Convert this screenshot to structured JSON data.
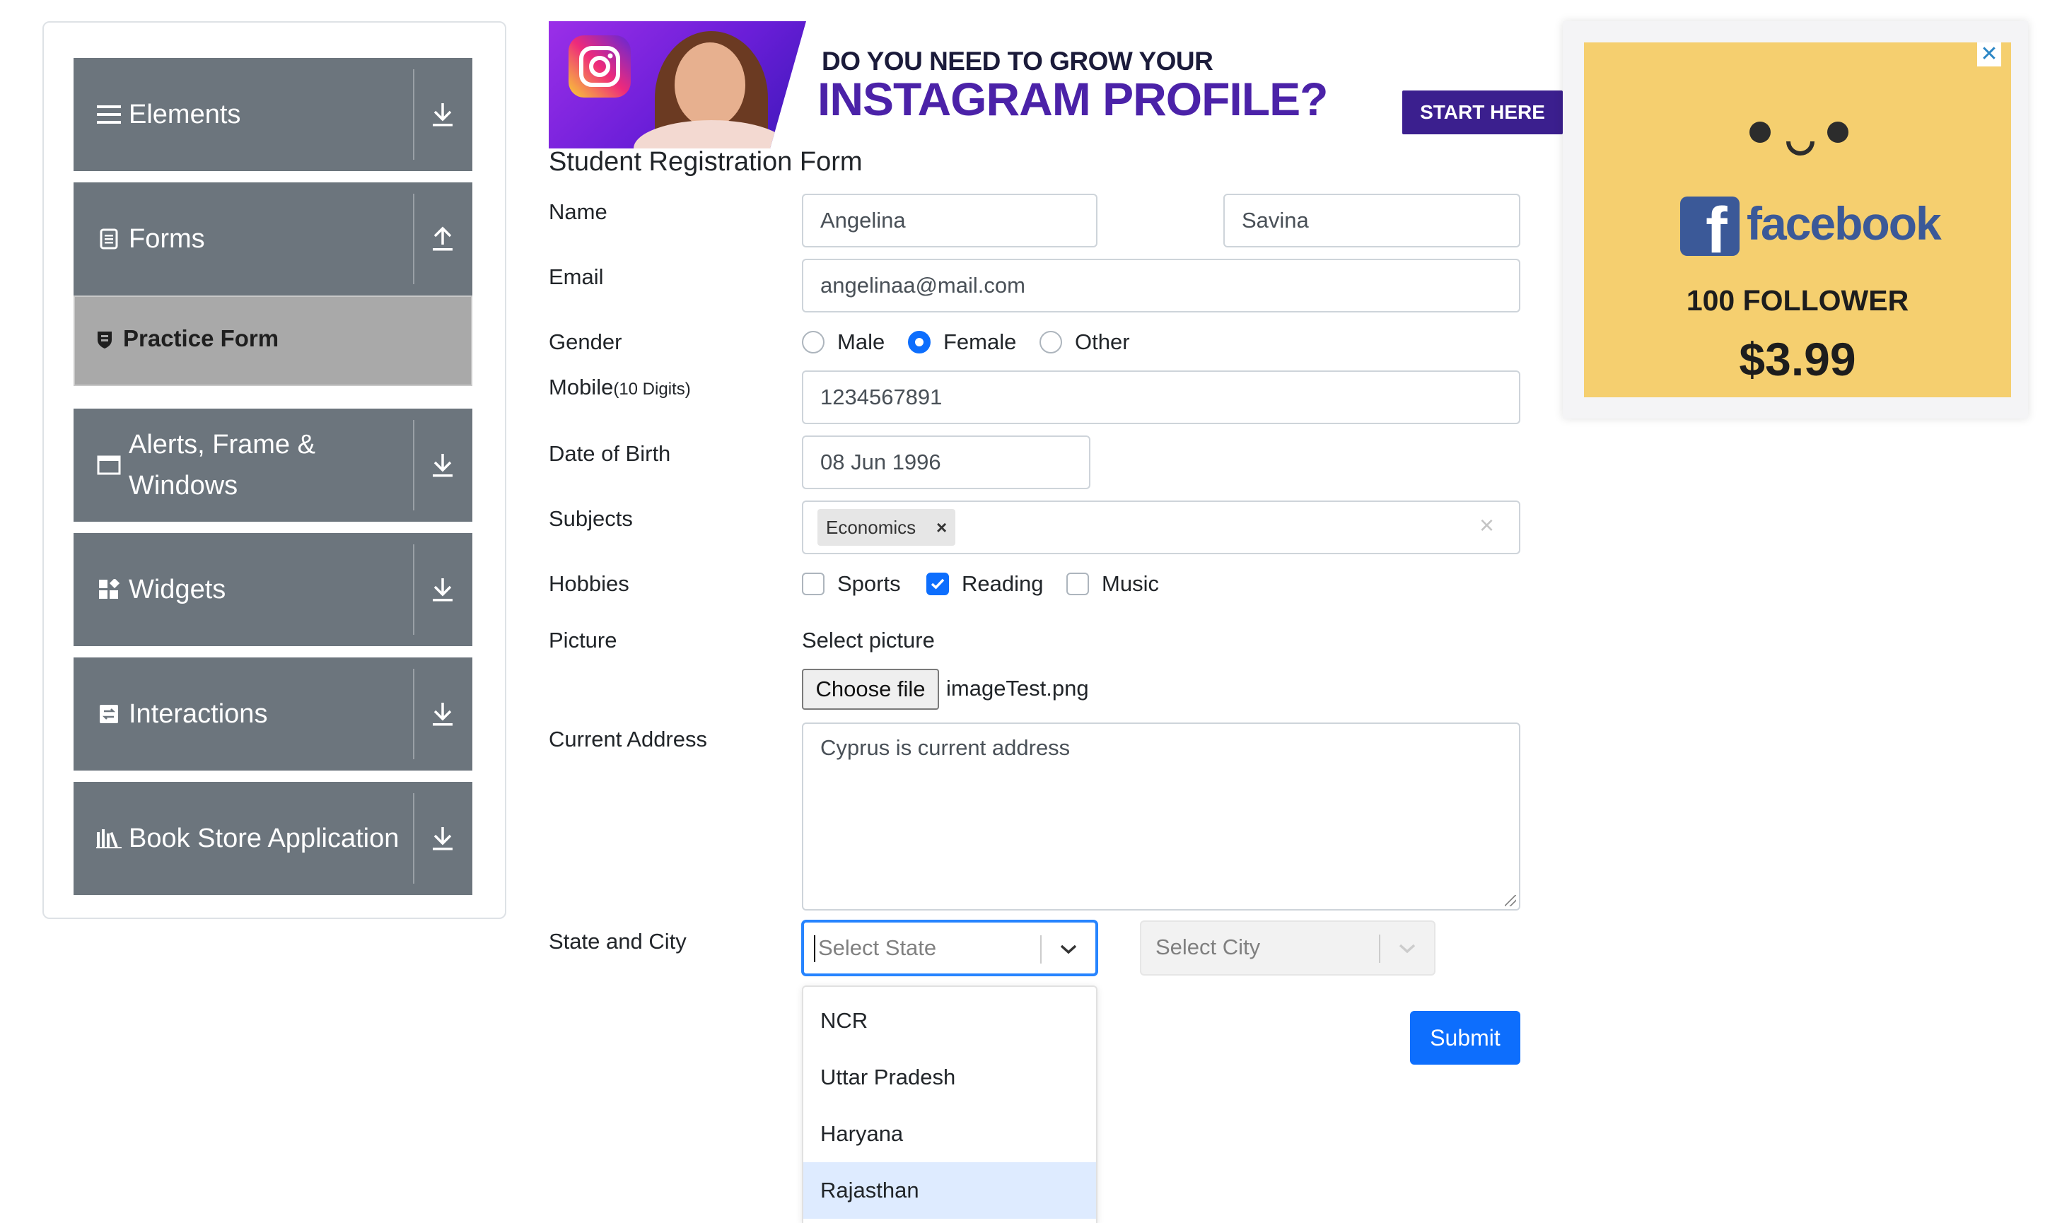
{
  "sidebar": {
    "groups": [
      {
        "label": "Elements",
        "icon": "list-icon",
        "arrow": "download-arrow-icon"
      },
      {
        "label": "Forms",
        "icon": "document-icon",
        "arrow": "upload-arrow-icon"
      },
      {
        "label": "Alerts, Frame & Windows",
        "icon": "window-icon",
        "arrow": "download-arrow-icon"
      },
      {
        "label": "Widgets",
        "icon": "widgets-icon",
        "arrow": "download-arrow-icon"
      },
      {
        "label": "Interactions",
        "icon": "interaction-icon",
        "arrow": "download-arrow-icon"
      },
      {
        "label": "Book Store Application",
        "icon": "books-icon",
        "arrow": "download-arrow-icon"
      }
    ],
    "active_item": {
      "label": "Practice Form",
      "icon": "shield-icon"
    }
  },
  "top_ad": {
    "line1": "DO YOU NEED TO GROW YOUR",
    "line2": "INSTAGRAM PROFILE?",
    "cta": "START HERE"
  },
  "side_ad": {
    "brand": "facebook",
    "brand_letter": "f",
    "headline": "100 FOLLOWER",
    "price": "$3.99",
    "close": "✕"
  },
  "form": {
    "title": "Student Registration Form",
    "name": {
      "label": "Name",
      "first": "Angelina",
      "last": "Savina"
    },
    "email": {
      "label": "Email",
      "value": "angelinaa@mail.com"
    },
    "gender": {
      "label": "Gender",
      "options": [
        "Male",
        "Female",
        "Other"
      ],
      "selected": "Female"
    },
    "mobile": {
      "label": "Mobile",
      "hint": "(10 Digits)",
      "value": "1234567891"
    },
    "dob": {
      "label": "Date of Birth",
      "value": "08 Jun 1996"
    },
    "subjects": {
      "label": "Subjects",
      "chip": "Economics",
      "chip_remove": "×",
      "clear": "×"
    },
    "hobbies": {
      "label": "Hobbies",
      "options": [
        "Sports",
        "Reading",
        "Music"
      ],
      "checked": [
        "Reading"
      ]
    },
    "picture": {
      "label": "Picture",
      "select_text": "Select picture",
      "button": "Choose file",
      "file_name": "imageTest.png"
    },
    "address": {
      "label": "Current Address",
      "value": "Cyprus is current address"
    },
    "state_city": {
      "label": "State and City",
      "state_placeholder": "Select State",
      "city_placeholder": "Select City",
      "state_options": [
        "NCR",
        "Uttar Pradesh",
        "Haryana",
        "Rajasthan"
      ],
      "focused_option": "Rajasthan"
    },
    "submit": "Submit"
  },
  "colors": {
    "sidebar_header": "#6c757d",
    "active_item": "#a9a9a9",
    "primary": "#0d6efd",
    "focus_border": "#2684ff",
    "option_focus": "#deebff"
  }
}
